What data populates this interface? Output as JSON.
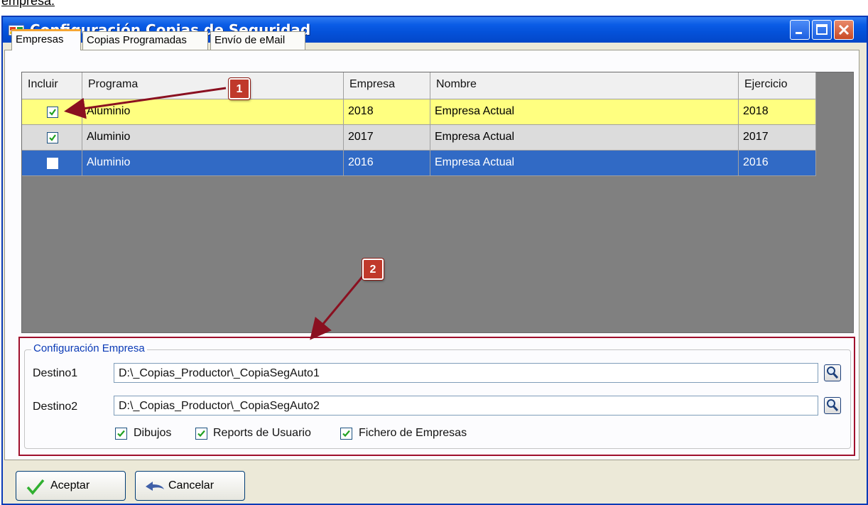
{
  "page": {
    "heading_fragment": "empresa."
  },
  "window": {
    "title": "Configuración Copias de Seguridad",
    "colors": {
      "title_bar": "#0451d9",
      "title_text": "#ffffff",
      "row_highlight": "#ffff80",
      "row_selected": "#316ac5",
      "annotation": "#c0392b"
    }
  },
  "tabs": [
    {
      "label": "Empresas",
      "active": true
    },
    {
      "label": "Copias Programadas",
      "active": false
    },
    {
      "label": "Envío de eMail",
      "active": false
    }
  ],
  "grid": {
    "columns": [
      "Incluir",
      "Programa",
      "Empresa",
      "Nombre",
      "Ejercicio"
    ],
    "rows": [
      {
        "incluir": true,
        "programa": "Aluminio",
        "empresa": "2018",
        "nombre": "Empresa Actual",
        "ejercicio": "2018",
        "state": "highlighted"
      },
      {
        "incluir": true,
        "programa": "Aluminio",
        "empresa": "2017",
        "nombre": "Empresa Actual",
        "ejercicio": "2017",
        "state": "normal"
      },
      {
        "incluir": false,
        "programa": "Aluminio",
        "empresa": "2016",
        "nombre": "Empresa Actual",
        "ejercicio": "2016",
        "state": "selected"
      }
    ]
  },
  "annotations": [
    {
      "label": "1"
    },
    {
      "label": "2"
    }
  ],
  "config": {
    "legend": "Configuración Empresa",
    "destino1_label": "Destino1",
    "destino1_value": "D:\\_Copias_Productor\\_CopiaSegAuto1",
    "destino2_label": "Destino2",
    "destino2_value": "D:\\_Copias_Productor\\_CopiaSegAuto2",
    "options": [
      {
        "label": "Dibujos",
        "checked": true
      },
      {
        "label": "Reports de Usuario",
        "checked": true
      },
      {
        "label": "Fichero de Empresas",
        "checked": true
      }
    ]
  },
  "buttons": {
    "accept": "Aceptar",
    "cancel": "Cancelar"
  },
  "icons": [
    "window-app-icon",
    "minimize-icon",
    "maximize-icon",
    "close-icon",
    "magnifier-icon",
    "checkmark-icon",
    "back-arrow-icon"
  ]
}
